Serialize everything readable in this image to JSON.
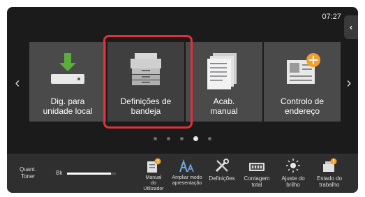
{
  "status": {
    "time": "07:27"
  },
  "tiles": [
    {
      "label_line1": "Dig. para",
      "label_line2": "unidade local"
    },
    {
      "label_line1": "Definições de",
      "label_line2": "bandeja"
    },
    {
      "label_line1": "Acab.",
      "label_line2": "manual"
    },
    {
      "label_line1": "Controlo de",
      "label_line2": "endereço"
    }
  ],
  "toner": {
    "label_line1": "Quant.",
    "label_line2": "Toner",
    "color": "Bk",
    "level": 0.9
  },
  "quick": [
    {
      "line1": "Manual",
      "line2": "do",
      "line3": "Utilizador"
    },
    {
      "line1": "Ampliar modo",
      "line2": "apresentação"
    },
    {
      "line1": "Definições"
    },
    {
      "line1": "Contagem",
      "line2": "total"
    },
    {
      "line1": "Ajuste do",
      "line2": "brilho"
    },
    {
      "line1": "Estado do",
      "line2": "trabalho"
    }
  ],
  "colors": {
    "accent": "#e0303a",
    "badge": "#f0a030",
    "icon_green": "#5aae3c"
  },
  "icons": [
    "chevron-left-icon",
    "chevron-right-icon",
    "download-icon",
    "printer-icon",
    "documents-icon",
    "address-book-icon"
  ]
}
